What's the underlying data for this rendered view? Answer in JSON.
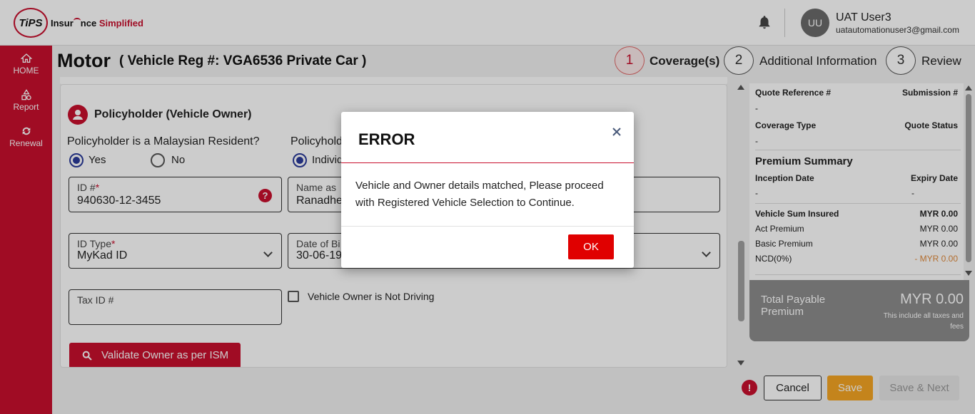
{
  "header": {
    "logo_mark": "TiPS",
    "logo_text_a": "Insur",
    "logo_text_b": "nce",
    "logo_text_c": "Simplified",
    "user_initials": "UU",
    "user_name": "UAT User3",
    "user_email": "uatautomationuser3@gmail.com"
  },
  "sidebar": {
    "items": [
      {
        "label": "HOME",
        "icon": "home-icon"
      },
      {
        "label": "Report",
        "icon": "report-icon"
      },
      {
        "label": "Renewal",
        "icon": "renewal-icon"
      }
    ]
  },
  "page": {
    "title": "Motor",
    "subtitle": "( Vehicle Reg #: VGA6536 Private Car )"
  },
  "steps": [
    {
      "number": "1",
      "label": "Coverage(s)",
      "active": true
    },
    {
      "number": "2",
      "label": "Additional Information",
      "active": false
    },
    {
      "number": "3",
      "label": "Review",
      "active": false
    }
  ],
  "form": {
    "section_title": "Policyholder (Vehicle Owner)",
    "resident_question": "Policyholder is a Malaysian Resident?",
    "resident_yes": "Yes",
    "resident_no": "No",
    "type_question": "Policyhold",
    "type_individual": "Individ",
    "id_label": "ID #",
    "id_required": "*",
    "id_value": "940630-12-3455",
    "help_badge": "?",
    "name_label": "Name as",
    "name_value": "Ranadhe",
    "id_type_label": "ID Type",
    "id_type_required": "*",
    "id_type_value": "MyKad ID",
    "dob_label": "Date of Bi",
    "dob_value": "30-06-19",
    "tax_label": "Tax ID #",
    "tax_value": "",
    "not_driving_label": "Vehicle Owner is Not Driving",
    "validate_label": "Validate Owner as per ISM"
  },
  "summary": {
    "quote_ref_label": "Quote Reference #",
    "quote_ref_value": "-",
    "submission_label": "Submission #",
    "coverage_type_label": "Coverage Type",
    "coverage_type_value": "-",
    "quote_status_label": "Quote Status",
    "premium_summary_title": "Premium Summary",
    "inception_label": "Inception Date",
    "inception_value": "-",
    "expiry_label": "Expiry Date",
    "expiry_value": "-",
    "rows": [
      {
        "label": "Vehicle Sum Insured",
        "value": "MYR 0.00",
        "bold": true
      },
      {
        "label": "Act Premium",
        "value": "MYR 0.00",
        "bold": false
      },
      {
        "label": "Basic Premium",
        "value": "MYR 0.00",
        "bold": false
      },
      {
        "label": "NCD(0%)",
        "value": "- MYR 0.00",
        "bold": false
      }
    ],
    "total_label": "Total Payable Premium",
    "total_value": "MYR 0.00",
    "total_note": "This include all taxes and fees"
  },
  "footer": {
    "warning": "!",
    "cancel": "Cancel",
    "save": "Save",
    "save_next": "Save & Next"
  },
  "modal": {
    "title": "ERROR",
    "message": "Vehicle and Owner details matched, Please proceed with Registered Vehicle Selection to Continue.",
    "ok": "OK"
  },
  "colors": {
    "brand_red": "#c8102e",
    "save_orange": "#f5a623",
    "ok_red": "#e00000",
    "radio_blue": "#2a3a9a",
    "ncd_orange": "#e08a3c"
  }
}
